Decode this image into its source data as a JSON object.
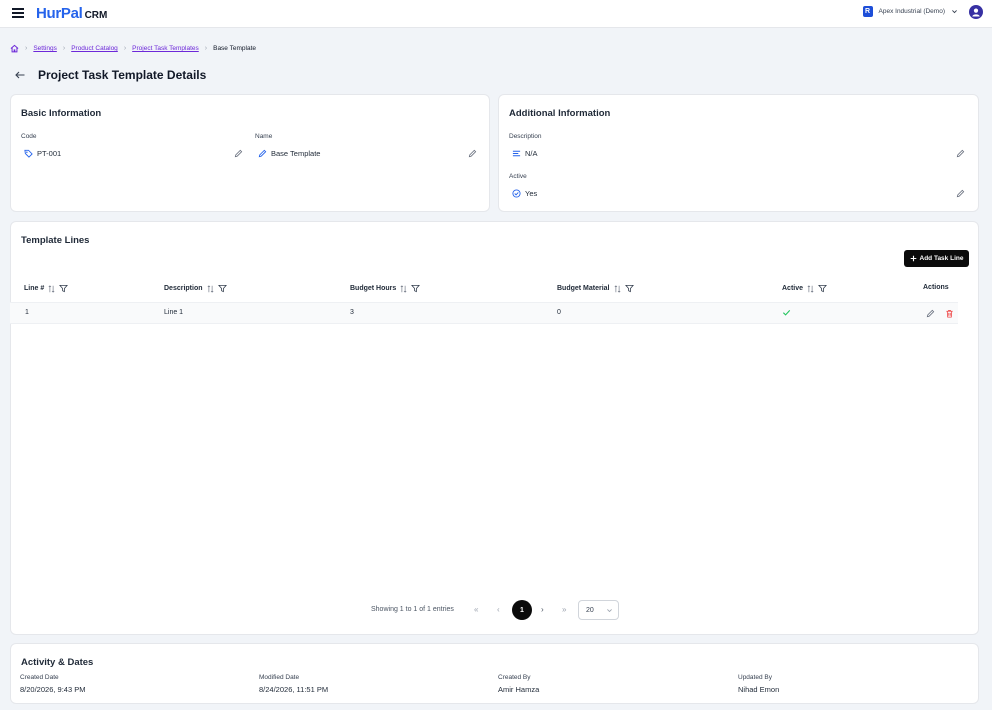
{
  "header": {
    "logo_main": "HurPal",
    "logo_sub": "CRM",
    "tenant_initial": "R",
    "tenant_name": "Apex Industrial (Demo)"
  },
  "breadcrumb": {
    "items": [
      "Settings",
      "Product Catalog",
      "Project Task Templates"
    ],
    "current": "Base Template"
  },
  "page": {
    "title": "Project Task Template Details"
  },
  "basic_info": {
    "title": "Basic Information",
    "code_label": "Code",
    "code_value": "PT-001",
    "name_label": "Name",
    "name_value": "Base Template"
  },
  "additional_info": {
    "title": "Additional Information",
    "description_label": "Description",
    "description_value": "N/A",
    "active_label": "Active",
    "active_value": "Yes"
  },
  "template_lines": {
    "title": "Template Lines",
    "add_button": "Add Task Line",
    "columns": [
      "Line #",
      "Description",
      "Budget Hours",
      "Budget Material",
      "Active",
      "Actions"
    ],
    "rows": [
      {
        "line": "1",
        "description": "Line 1",
        "budget_hours": "3",
        "budget_material": "0",
        "active": true
      }
    ],
    "pagination": {
      "info": "Showing 1 to 1 of 1 entries",
      "current_page": "1",
      "page_size": "20"
    }
  },
  "activity": {
    "title": "Activity & Dates",
    "created_date_label": "Created Date",
    "created_date": "8/20/2026, 9:43 PM",
    "modified_date_label": "Modified Date",
    "modified_date": "8/24/2026, 11:51 PM",
    "created_by_label": "Created By",
    "created_by": "Amir Hamza",
    "updated_by_label": "Updated By",
    "updated_by": "Nihad Emon"
  },
  "colors": {
    "brand": "#2563eb",
    "link": "#6d28d9",
    "active_check": "#22c55e",
    "delete": "#ef4444"
  }
}
